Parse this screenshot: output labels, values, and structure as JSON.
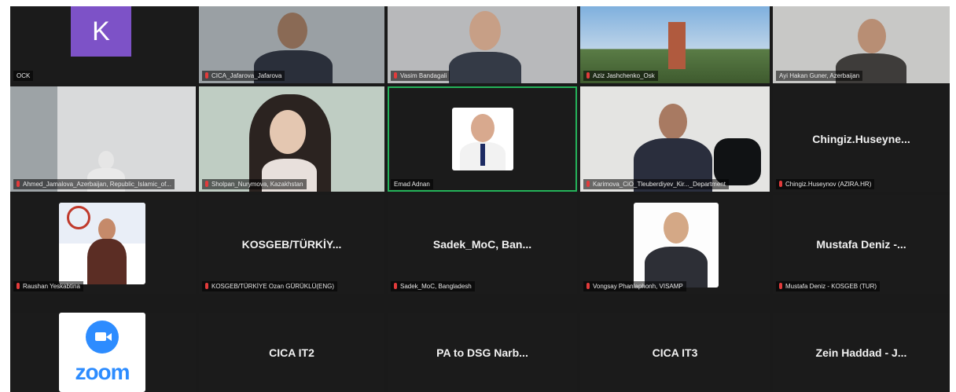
{
  "participants": [
    {
      "display": "K",
      "name": "OCK"
    },
    {
      "name": "CICA_Jafarova_Jafarova"
    },
    {
      "name": "Vasim Bandagali"
    },
    {
      "name": "Aziz Jashchenko_Osk"
    },
    {
      "name": "Ayi Hakan Guner, Azerbaijan"
    },
    {
      "name": "Ahmed_Jamalova_Azerbaijan, Republic_Islamic_of..."
    },
    {
      "name": "Sholpan_Nurymova, Kazakhstan"
    },
    {
      "name": "Emad Adnan"
    },
    {
      "name": "Karimova_CiO_Tleuberdiyev_Kir..._Department"
    },
    {
      "display": "Chingiz.Huseyne...",
      "name": "Chingiz.Huseynov (AZIRA.HR)"
    },
    {
      "name": "Raushan Yeskabtina"
    },
    {
      "display": "KOSGEB/TÜRKİY...",
      "name": "KOSGEB/TÜRKİYE Ozan GÜRÜKLÜ(ENG)"
    },
    {
      "display": "Sadek_MoC, Ban...",
      "name": "Sadek_MoC, Bangladesh"
    },
    {
      "name": "Vongsay Phanlaphonh, VISAMP"
    },
    {
      "display": "Mustafa Deniz -...",
      "name": "Mustafa Deniz - KOSGEB (TUR)"
    },
    {
      "name": "ZOOM"
    },
    {
      "display": "CICA IT2"
    },
    {
      "display": "PA to DSG Narb..."
    },
    {
      "display": "CICA IT3"
    },
    {
      "display": "Zein Haddad - J..."
    }
  ],
  "zoom_logo_text": "zoom",
  "colors": {
    "active_border": "#24b35a",
    "tile_bg": "#1b1b1b",
    "zoom_blue": "#2d8cff",
    "avatar_purple": "#7d52c7"
  }
}
